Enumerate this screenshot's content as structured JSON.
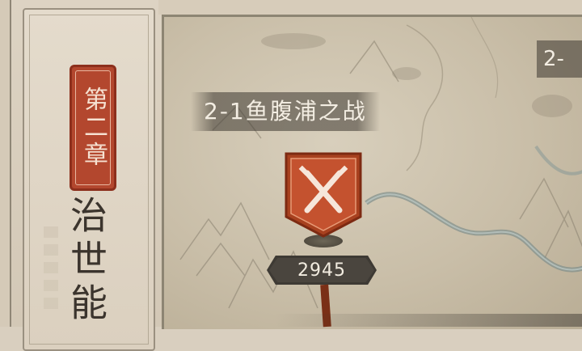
{
  "chapter": {
    "badge": "第二章",
    "title": "治世能"
  },
  "stage": {
    "current_label": "2-1鱼腹浦之战",
    "next_label": "2-",
    "power": "2945",
    "flag_icon": "crossed-swords-icon"
  },
  "colors": {
    "badge_red": "#b3472e",
    "flag_orange": "#c4522f",
    "map_parchment": "#c9bea8",
    "plate_dark": "#3e3a34"
  }
}
